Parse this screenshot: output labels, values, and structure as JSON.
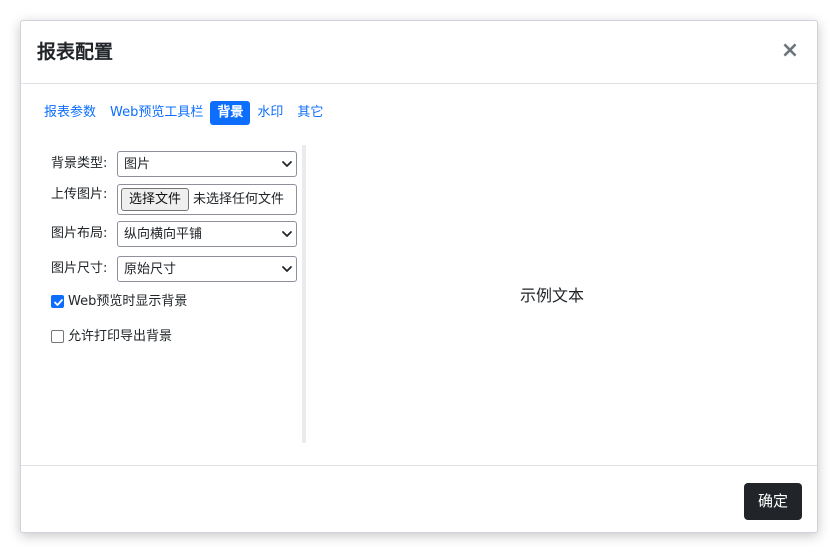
{
  "dialog": {
    "title": "报表配置",
    "close_label": "×"
  },
  "tabs": [
    {
      "label": "报表参数",
      "active": false
    },
    {
      "label": "Web预览工具栏",
      "active": false
    },
    {
      "label": "背景",
      "active": true
    },
    {
      "label": "水印",
      "active": false
    },
    {
      "label": "其它",
      "active": false
    }
  ],
  "form": {
    "background_type": {
      "label": "背景类型:",
      "value": "图片"
    },
    "upload_image": {
      "label": "上传图片:",
      "button_label": "选择文件",
      "status": "未选择任何文件"
    },
    "image_layout": {
      "label": "图片布局:",
      "value": "纵向横向平铺"
    },
    "image_size": {
      "label": "图片尺寸:",
      "value": "原始尺寸"
    },
    "show_in_web_preview": {
      "label": "Web预览时显示背景",
      "checked": true
    },
    "allow_print_export": {
      "label": "允许打印导出背景",
      "checked": false
    }
  },
  "preview": {
    "sample_text": "示例文本"
  },
  "footer": {
    "confirm_label": "确定"
  },
  "colors": {
    "accent": "#0d6efd",
    "confirm_button": "#212529",
    "title_text": "#212529",
    "close_icon": "#6c757d"
  },
  "icons": {
    "close": "close-icon",
    "select_arrow": "chevron-down-icon",
    "check": "check-icon"
  }
}
